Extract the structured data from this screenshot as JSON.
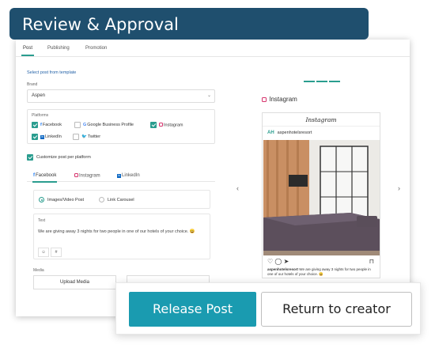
{
  "banner": {
    "title": "Review & Approval"
  },
  "tabs": [
    "Post",
    "Publishing",
    "Promotion"
  ],
  "template_link": "Select post from template",
  "brand": {
    "label": "Brand",
    "value": "Aspen"
  },
  "platforms": {
    "label": "Platforms",
    "items": [
      {
        "name": "Facebook",
        "checked": true,
        "icon": "facebook-icon"
      },
      {
        "name": "Google Business Profile",
        "checked": false,
        "icon": "google-icon"
      },
      {
        "name": "Instagram",
        "checked": true,
        "icon": "instagram-icon"
      },
      {
        "name": "LinkedIn",
        "checked": true,
        "icon": "linkedin-icon"
      },
      {
        "name": "Twitter",
        "checked": false,
        "icon": "twitter-icon"
      }
    ]
  },
  "customize_label": "Customize post per platform",
  "platform_tabs": [
    "Facebook",
    "Instagram",
    "LinkedIn"
  ],
  "post_types": [
    "Images/Video Post",
    "Link Carousel"
  ],
  "text": {
    "label": "Text",
    "content": "We are giving away 3 nights for two people in one of our hotels of your choice. 😀",
    "tools": [
      "☺",
      "#"
    ]
  },
  "media": {
    "label": "Media",
    "upload_label": "Upload Media",
    "second_label": ""
  },
  "preview": {
    "label": "Instagram",
    "header": "Instagram",
    "avatar": "AH",
    "account": "aspenhotelsresort",
    "caption_user": "aspenhotelsresort",
    "caption_text": "We are giving away 3 nights for two people in one of our hotels of your choice. 😀"
  },
  "actions": {
    "release": "Release Post",
    "return": "Return to creator"
  },
  "colors": {
    "banner": "#1f4f6e",
    "accent": "#2a9d8f",
    "release": "#1a9bb0"
  }
}
